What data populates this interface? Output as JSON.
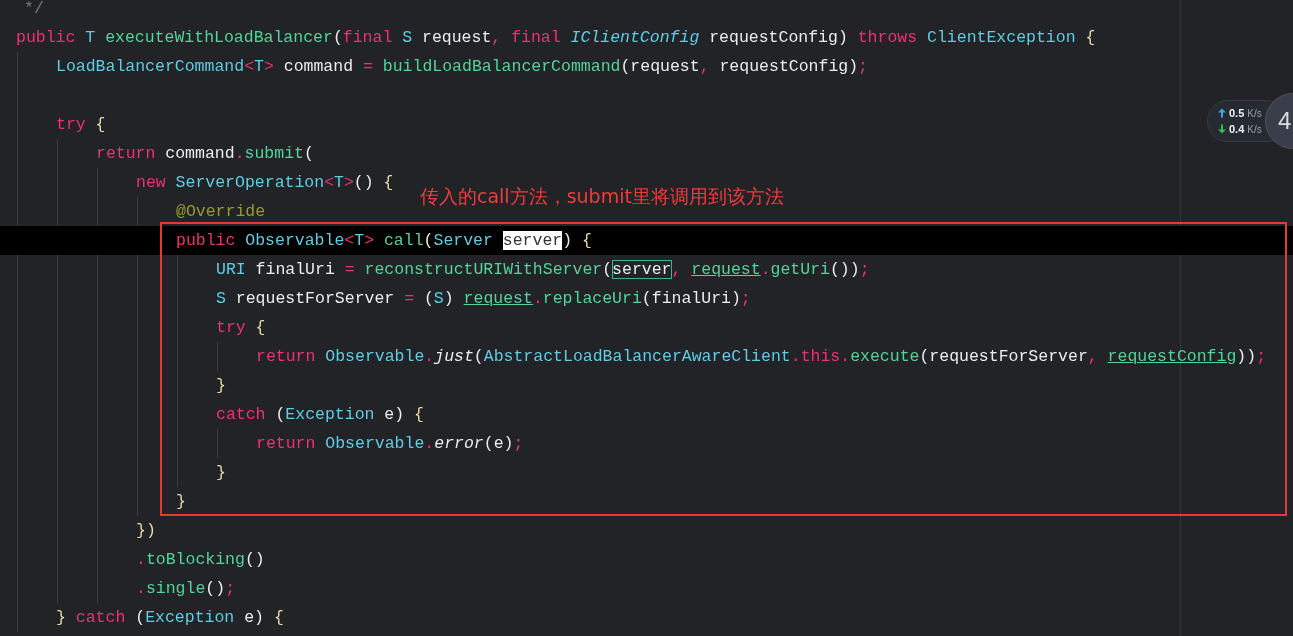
{
  "editor": {
    "lines": [
      {
        "kind": "code",
        "selected": false,
        "tokens": [
          {
            "text": "*/",
            "kind": "comment"
          }
        ]
      },
      {
        "kind": "code",
        "selected": false,
        "tokens": [
          {
            "text": "public ",
            "kind": "keyword"
          },
          {
            "text": "T ",
            "kind": "type"
          },
          {
            "text": "executeWithLoadBalancer",
            "kind": "function"
          },
          {
            "text": "(",
            "kind": "plain"
          },
          {
            "text": "final ",
            "kind": "keyword"
          },
          {
            "text": "S ",
            "kind": "type"
          },
          {
            "text": "request",
            "kind": "plain"
          },
          {
            "text": ", ",
            "kind": "punct"
          },
          {
            "text": "final ",
            "kind": "keyword"
          },
          {
            "text": "IClientConfig ",
            "kind": "italic-type"
          },
          {
            "text": "requestConfig) ",
            "kind": "plain"
          },
          {
            "text": "throws ",
            "kind": "keyword"
          },
          {
            "text": "ClientException ",
            "kind": "type"
          },
          {
            "text": "{",
            "kind": "brace"
          }
        ],
        "children": [
          {
            "kind": "code",
            "selected": false,
            "tokens": [
              {
                "text": "LoadBalancerCommand",
                "kind": "type"
              },
              {
                "text": "<",
                "kind": "punct"
              },
              {
                "text": "T",
                "kind": "type"
              },
              {
                "text": "> ",
                "kind": "punct"
              },
              {
                "text": "command ",
                "kind": "plain"
              },
              {
                "text": "= ",
                "kind": "punct"
              },
              {
                "text": "buildLoadBalancerCommand",
                "kind": "function"
              },
              {
                "text": "(request",
                "kind": "plain"
              },
              {
                "text": ", ",
                "kind": "punct"
              },
              {
                "text": "requestConfig)",
                "kind": "plain"
              },
              {
                "text": ";",
                "kind": "punct"
              }
            ]
          },
          {
            "kind": "blank"
          },
          {
            "kind": "code",
            "selected": false,
            "tokens": [
              {
                "text": "try ",
                "kind": "keyword"
              },
              {
                "text": "{",
                "kind": "brace"
              }
            ],
            "children": [
              {
                "kind": "code",
                "selected": false,
                "tokens": [
                  {
                    "text": "return ",
                    "kind": "keyword"
                  },
                  {
                    "text": "command",
                    "kind": "plain"
                  },
                  {
                    "text": ".",
                    "kind": "punct"
                  },
                  {
                    "text": "submit",
                    "kind": "function"
                  },
                  {
                    "text": "(",
                    "kind": "plain"
                  }
                ],
                "children": [
                  {
                    "kind": "code",
                    "selected": false,
                    "tokens": [
                      {
                        "text": "new ",
                        "kind": "keyword"
                      },
                      {
                        "text": "ServerOperation",
                        "kind": "type"
                      },
                      {
                        "text": "<",
                        "kind": "punct"
                      },
                      {
                        "text": "T",
                        "kind": "type"
                      },
                      {
                        "text": ">",
                        "kind": "punct"
                      },
                      {
                        "text": "() ",
                        "kind": "plain"
                      },
                      {
                        "text": "{",
                        "kind": "brace"
                      }
                    ],
                    "children": [
                      {
                        "kind": "code",
                        "selected": false,
                        "tokens": [
                          {
                            "text": "@Override",
                            "kind": "annotation"
                          }
                        ]
                      },
                      {
                        "kind": "code",
                        "selected": true,
                        "tokens": [
                          {
                            "text": "public ",
                            "kind": "keyword"
                          },
                          {
                            "text": "Observable",
                            "kind": "type"
                          },
                          {
                            "text": "<",
                            "kind": "punct"
                          },
                          {
                            "text": "T",
                            "kind": "type"
                          },
                          {
                            "text": "> ",
                            "kind": "punct"
                          },
                          {
                            "text": "call",
                            "kind": "function"
                          },
                          {
                            "text": "(",
                            "kind": "plain"
                          },
                          {
                            "text": "Server ",
                            "kind": "type"
                          },
                          {
                            "text": "server",
                            "kind": "selected-word"
                          },
                          {
                            "text": ") ",
                            "kind": "plain"
                          },
                          {
                            "text": "{",
                            "kind": "brace"
                          }
                        ],
                        "children": [
                          {
                            "kind": "code",
                            "selected": false,
                            "tokens": [
                              {
                                "text": "URI ",
                                "kind": "type"
                              },
                              {
                                "text": "finalUri ",
                                "kind": "plain"
                              },
                              {
                                "text": "= ",
                                "kind": "punct"
                              },
                              {
                                "text": "reconstructURIWithServer",
                                "kind": "function"
                              },
                              {
                                "text": "(",
                                "kind": "plain"
                              },
                              {
                                "text": "server",
                                "kind": "matched-word"
                              },
                              {
                                "text": ", ",
                                "kind": "punct"
                              },
                              {
                                "text": "request",
                                "kind": "field"
                              },
                              {
                                "text": ".",
                                "kind": "punct"
                              },
                              {
                                "text": "getUri",
                                "kind": "function"
                              },
                              {
                                "text": "())",
                                "kind": "plain"
                              },
                              {
                                "text": ";",
                                "kind": "punct"
                              }
                            ]
                          },
                          {
                            "kind": "code",
                            "selected": false,
                            "tokens": [
                              {
                                "text": "S ",
                                "kind": "type"
                              },
                              {
                                "text": "requestForServer ",
                                "kind": "plain"
                              },
                              {
                                "text": "= ",
                                "kind": "punct"
                              },
                              {
                                "text": "(",
                                "kind": "plain"
                              },
                              {
                                "text": "S",
                                "kind": "type"
                              },
                              {
                                "text": ") ",
                                "kind": "plain"
                              },
                              {
                                "text": "request",
                                "kind": "field"
                              },
                              {
                                "text": ".",
                                "kind": "punct"
                              },
                              {
                                "text": "replaceUri",
                                "kind": "function"
                              },
                              {
                                "text": "(finalUri)",
                                "kind": "plain"
                              },
                              {
                                "text": ";",
                                "kind": "punct"
                              }
                            ]
                          },
                          {
                            "kind": "code",
                            "selected": false,
                            "tokens": [
                              {
                                "text": "try ",
                                "kind": "keyword"
                              },
                              {
                                "text": "{",
                                "kind": "brace"
                              }
                            ],
                            "children": [
                              {
                                "kind": "code",
                                "selected": false,
                                "tokens": [
                                  {
                                    "text": "return ",
                                    "kind": "keyword"
                                  },
                                  {
                                    "text": "Observable",
                                    "kind": "type"
                                  },
                                  {
                                    "text": ".",
                                    "kind": "punct"
                                  },
                                  {
                                    "text": "just",
                                    "kind": "static-call"
                                  },
                                  {
                                    "text": "(",
                                    "kind": "plain"
                                  },
                                  {
                                    "text": "AbstractLoadBalancerAwareClient",
                                    "kind": "type"
                                  },
                                  {
                                    "text": ".",
                                    "kind": "punct"
                                  },
                                  {
                                    "text": "this",
                                    "kind": "keyword"
                                  },
                                  {
                                    "text": ".",
                                    "kind": "punct"
                                  },
                                  {
                                    "text": "execute",
                                    "kind": "function"
                                  },
                                  {
                                    "text": "(requestForServer",
                                    "kind": "plain"
                                  },
                                  {
                                    "text": ", ",
                                    "kind": "punct"
                                  },
                                  {
                                    "text": "requestConfig",
                                    "kind": "field"
                                  },
                                  {
                                    "text": "))",
                                    "kind": "plain"
                                  },
                                  {
                                    "text": ";",
                                    "kind": "punct"
                                  }
                                ]
                              }
                            ]
                          },
                          {
                            "kind": "code",
                            "selected": false,
                            "tokens": [
                              {
                                "text": "}",
                                "kind": "brace"
                              }
                            ]
                          },
                          {
                            "kind": "code",
                            "selected": false,
                            "tokens": [
                              {
                                "text": "catch ",
                                "kind": "keyword"
                              },
                              {
                                "text": "(",
                                "kind": "plain"
                              },
                              {
                                "text": "Exception ",
                                "kind": "type"
                              },
                              {
                                "text": "e) ",
                                "kind": "plain"
                              },
                              {
                                "text": "{",
                                "kind": "brace"
                              }
                            ],
                            "children": [
                              {
                                "kind": "code",
                                "selected": false,
                                "tokens": [
                                  {
                                    "text": "return ",
                                    "kind": "keyword"
                                  },
                                  {
                                    "text": "Observable",
                                    "kind": "type"
                                  },
                                  {
                                    "text": ".",
                                    "kind": "punct"
                                  },
                                  {
                                    "text": "error",
                                    "kind": "static-call"
                                  },
                                  {
                                    "text": "(e)",
                                    "kind": "plain"
                                  },
                                  {
                                    "text": ";",
                                    "kind": "punct"
                                  }
                                ]
                              }
                            ]
                          },
                          {
                            "kind": "code",
                            "selected": false,
                            "tokens": [
                              {
                                "text": "}",
                                "kind": "brace"
                              }
                            ]
                          }
                        ]
                      },
                      {
                        "kind": "code",
                        "selected": false,
                        "tokens": [
                          {
                            "text": "}",
                            "kind": "brace"
                          }
                        ]
                      }
                    ]
                  },
                  {
                    "kind": "code",
                    "selected": false,
                    "tokens": [
                      {
                        "text": "})",
                        "kind": "brace"
                      }
                    ]
                  },
                  {
                    "kind": "code",
                    "selected": false,
                    "tokens": [
                      {
                        "text": ".",
                        "kind": "punct"
                      },
                      {
                        "text": "toBlocking",
                        "kind": "function"
                      },
                      {
                        "text": "()",
                        "kind": "plain"
                      }
                    ]
                  },
                  {
                    "kind": "code",
                    "selected": false,
                    "tokens": [
                      {
                        "text": ".",
                        "kind": "punct"
                      },
                      {
                        "text": "single",
                        "kind": "function"
                      },
                      {
                        "text": "()",
                        "kind": "plain"
                      },
                      {
                        "text": ";",
                        "kind": "punct"
                      }
                    ]
                  }
                ]
              }
            ]
          },
          {
            "kind": "code",
            "selected": false,
            "tokens": [
              {
                "text": "} ",
                "kind": "brace"
              },
              {
                "text": "catch ",
                "kind": "keyword"
              },
              {
                "text": "(",
                "kind": "plain"
              },
              {
                "text": "Exception ",
                "kind": "type"
              },
              {
                "text": "e) ",
                "kind": "plain"
              },
              {
                "text": "{",
                "kind": "brace"
              }
            ]
          }
        ]
      }
    ]
  },
  "annotation": {
    "text": "传入的call方法，submit里将调用到该方法"
  },
  "network_monitor": {
    "upload": {
      "value": "0.5",
      "unit": "K/s"
    },
    "download": {
      "value": "0.4",
      "unit": "K/s"
    }
  },
  "floating_ball": {
    "text": "4"
  }
}
